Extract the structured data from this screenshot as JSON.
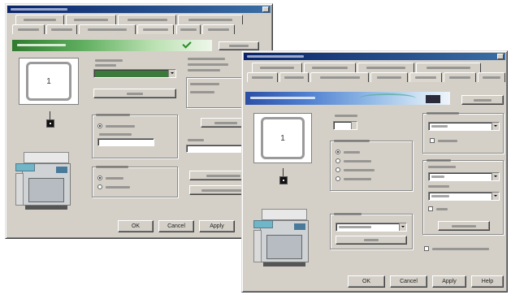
{
  "back_window": {
    "page_preview_number": "1",
    "buttons": {
      "ok": "OK",
      "cancel": "Cancel",
      "apply": "Apply"
    }
  },
  "front_window": {
    "page_preview_number": "1",
    "buttons": {
      "ok": "OK",
      "cancel": "Cancel",
      "apply": "Apply",
      "help": "Help"
    }
  },
  "icons": [
    "close-icon",
    "page-preview-icon",
    "staple-icon",
    "printer-image",
    "dropdown-arrow-icon"
  ],
  "colors": {
    "title_bar": "#0a246a",
    "dialog_face": "#d4d0c8",
    "back_banner": "#3c8c3c",
    "front_banner": "#2c4fa6"
  }
}
